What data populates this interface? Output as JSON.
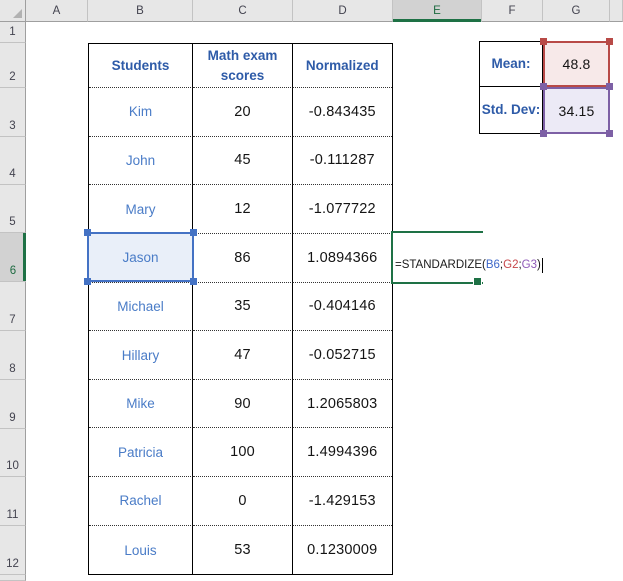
{
  "sheet": {
    "columns": [
      "A",
      "B",
      "C",
      "D",
      "E",
      "F",
      "G"
    ],
    "rows": [
      "1",
      "2",
      "3",
      "4",
      "5",
      "6",
      "7",
      "8",
      "9",
      "10",
      "11",
      "12"
    ],
    "selected_column": "E",
    "selected_row": "6"
  },
  "table": {
    "headers": [
      "Students",
      "Math exam scores",
      "Normalized"
    ],
    "rows": [
      {
        "name": "Kim",
        "score": "20",
        "normalized": "-0.843435"
      },
      {
        "name": "John",
        "score": "45",
        "normalized": "-0.111287"
      },
      {
        "name": "Mary",
        "score": "12",
        "normalized": "-1.077722"
      },
      {
        "name": "Jason",
        "score": "86",
        "normalized": "1.0894366"
      },
      {
        "name": "Michael",
        "score": "35",
        "normalized": "-0.404146"
      },
      {
        "name": "Hillary",
        "score": "47",
        "normalized": "-0.052715"
      },
      {
        "name": "Mike",
        "score": "90",
        "normalized": "1.2065803"
      },
      {
        "name": "Patricia",
        "score": "100",
        "normalized": "1.4994396"
      },
      {
        "name": "Rachel",
        "score": "0",
        "normalized": "-1.429153"
      },
      {
        "name": "Louis",
        "score": "53",
        "normalized": "0.1230009"
      }
    ]
  },
  "stats": {
    "mean_label": "Mean:",
    "mean_value": "48.8",
    "std_label": "Std. Dev:",
    "std_value": "34.15"
  },
  "formula": {
    "full": "=STANDARDIZE(B6;G2;G3)",
    "tokens": [
      "=STANDARDIZE(",
      "B6",
      ";",
      "G2",
      ";",
      "G3",
      ")"
    ]
  },
  "colors": {
    "accent_green": "#1e7145",
    "reference_blue": "#4472c4",
    "reference_red": "#b84a47",
    "reference_purple": "#7d60a5",
    "table_header_blue": "#2e5ba8",
    "student_name_blue": "#4a7cc7",
    "mean_fill": "#f7e9e9",
    "std_fill": "#eceaf6",
    "selection_fill": "#e9eff9",
    "selected_header_bg": "#d2d2d2"
  }
}
